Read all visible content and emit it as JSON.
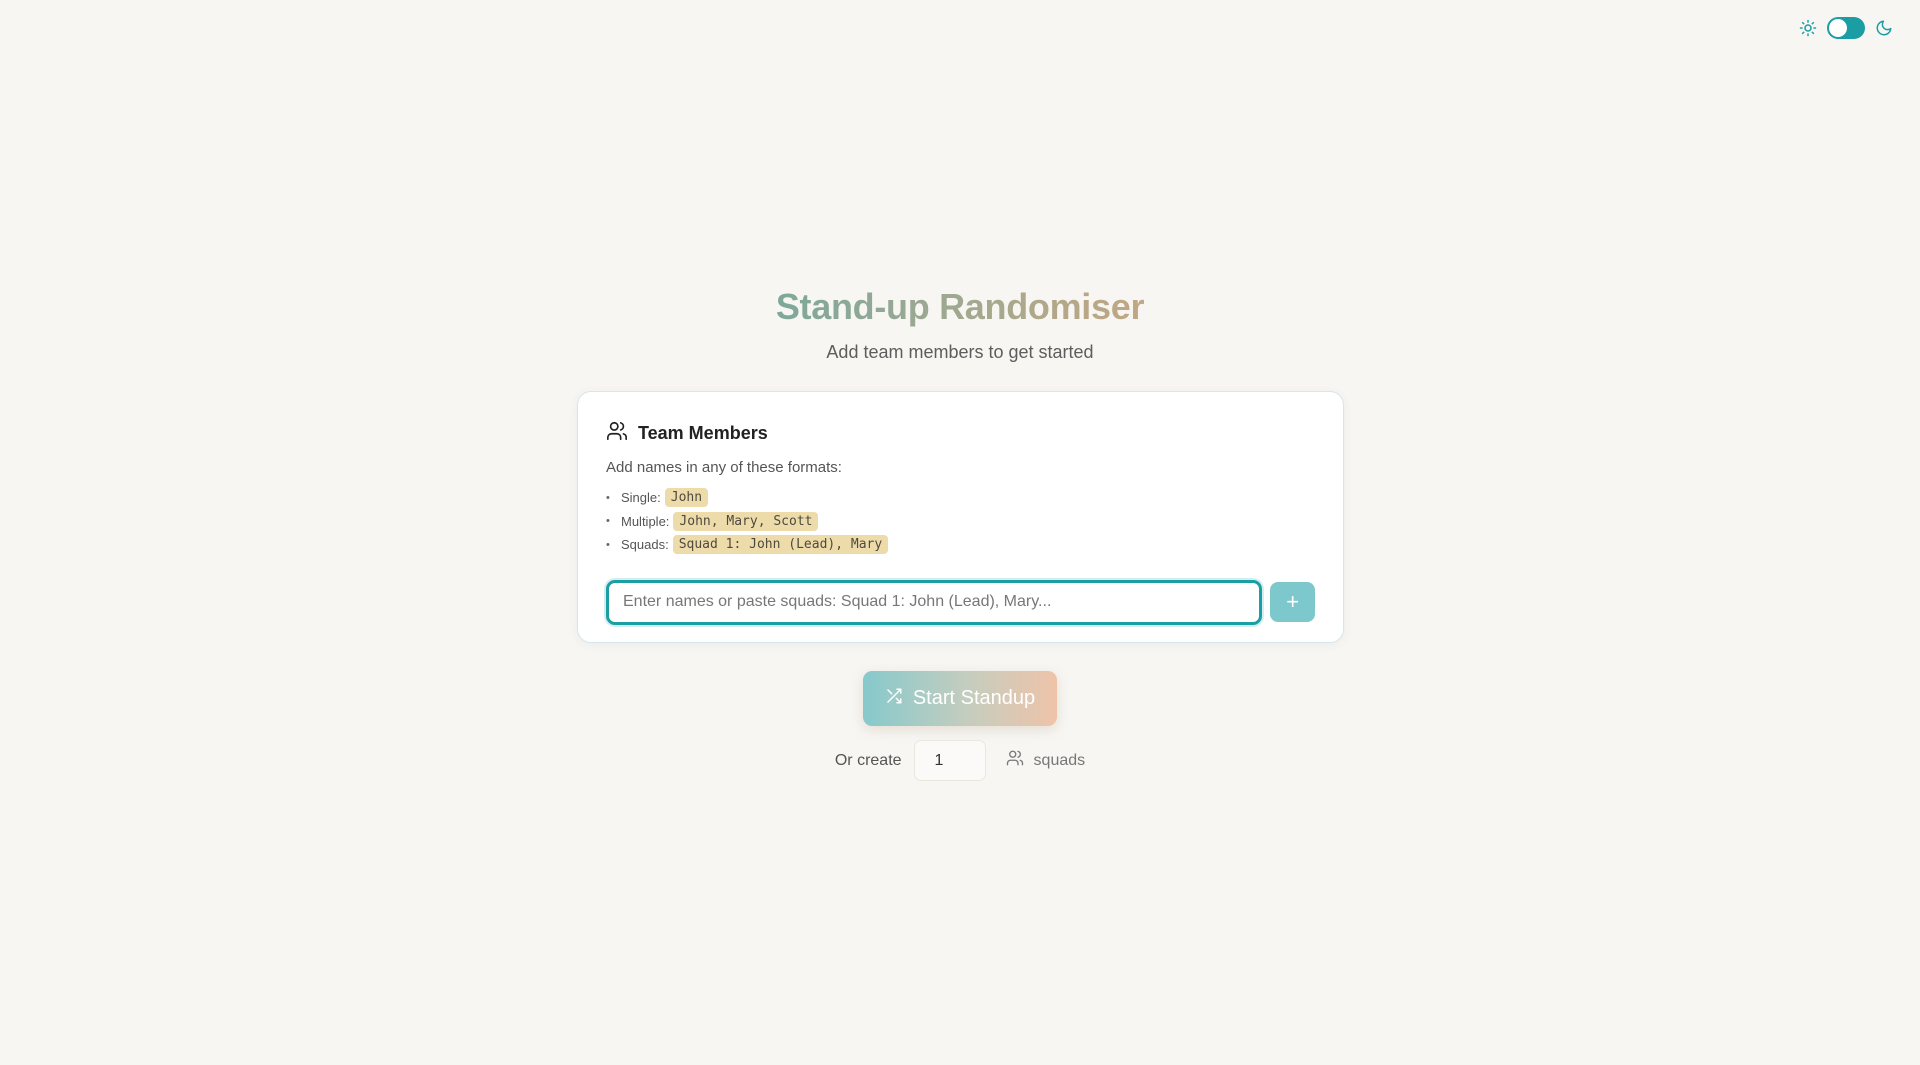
{
  "theme": {
    "accent": "#1a9ea3",
    "mode": "light"
  },
  "header": {
    "title": "Stand-up Randomiser",
    "subtitle": "Add team members to get started"
  },
  "team_card": {
    "title": "Team Members",
    "intro": "Add names in any of these formats:",
    "formats": [
      {
        "label": "Single:",
        "example": "John"
      },
      {
        "label": "Multiple:",
        "example": "John, Mary, Scott"
      },
      {
        "label": "Squads:",
        "example": "Squad 1: John (Lead), Mary"
      }
    ],
    "input": {
      "placeholder": "Enter names or paste squads: Squad 1: John (Lead), Mary...",
      "value": ""
    },
    "add_label": "+"
  },
  "start_button": {
    "label": "Start Standup"
  },
  "squads": {
    "prefix": "Or create",
    "count": "1",
    "suffix": "squads"
  }
}
